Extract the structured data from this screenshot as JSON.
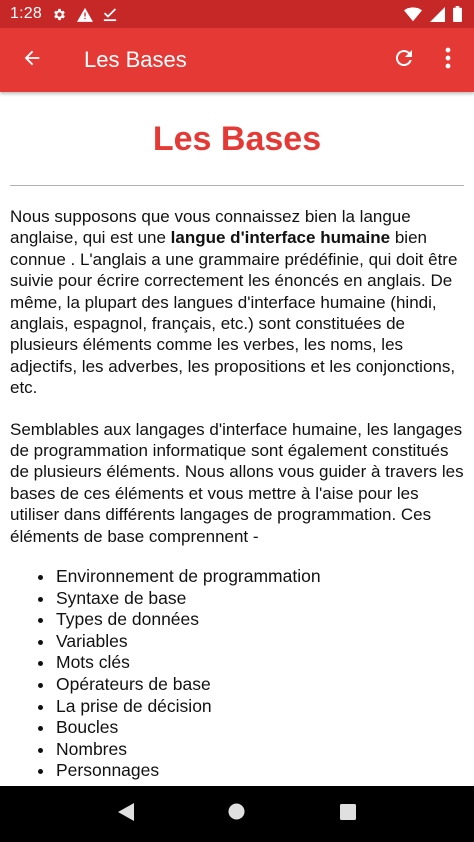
{
  "status_bar": {
    "time": "1:28",
    "left_icons": [
      "gear-icon",
      "warning-icon",
      "download-done-icon"
    ],
    "right_icons": [
      "wifi-icon",
      "cellular-icon",
      "battery-icon"
    ]
  },
  "app_bar": {
    "title": "Les Bases",
    "background": "#e53935",
    "status_background": "#c62828",
    "icons": [
      "arrow-back-icon",
      "refresh-icon",
      "more-vert-icon"
    ]
  },
  "article": {
    "title": "Les Bases",
    "title_color": "#e53935",
    "paragraph1": {
      "before": "Nous supposons que vous connaissez bien la langue anglaise, qui est une ",
      "bold": "langue d'interface humaine",
      "after": " bien connue . L'anglais a une grammaire prédéfinie, qui doit être suivie pour écrire correctement les énoncés en anglais. De même, la plupart des langues d'interface humaine (hindi, anglais, espagnol, français, etc.) sont constituées de plusieurs éléments comme les verbes, les noms, les adjectifs, les adverbes, les propositions et les conjonctions, etc."
    },
    "paragraph2": "Semblables aux langages d'interface humaine, les langages de programmation informatique sont également constitués de plusieurs éléments. Nous allons vous guider à travers les bases de ces éléments et vous mettre à l'aise pour les utiliser dans différents langages de programmation. Ces éléments de base comprennent -",
    "bullets": [
      "Environnement de programmation",
      "Syntaxe de base",
      "Types de données",
      "Variables",
      "Mots clés",
      "Opérateurs de base",
      "La prise de décision",
      "Boucles",
      "Nombres",
      "Personnages"
    ]
  },
  "nav_bar": {
    "icons": [
      "back-triangle-icon",
      "home-circle-icon",
      "recents-square-icon"
    ]
  }
}
